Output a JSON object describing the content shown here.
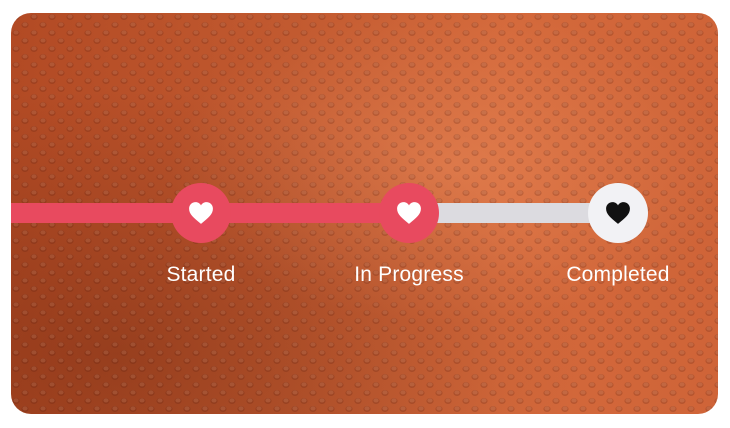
{
  "steps": [
    {
      "label": "Started",
      "status": "done",
      "icon": "heart-icon"
    },
    {
      "label": "In Progress",
      "status": "done",
      "icon": "heart-icon"
    },
    {
      "label": "Completed",
      "status": "pending",
      "icon": "heart-icon"
    }
  ],
  "colors": {
    "accent": "#e84a5f",
    "track_pending": "#dcdbe0",
    "node_pending": "#f2f2f5",
    "label": "#ffffff"
  },
  "background": {
    "image": "basketball-leather-texture"
  }
}
